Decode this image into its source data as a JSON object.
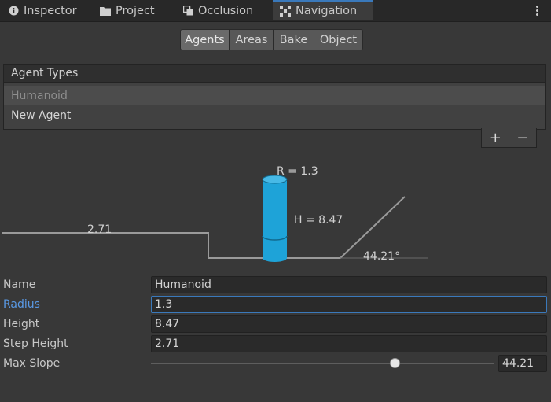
{
  "tabs": [
    {
      "label": "Inspector",
      "icon": "info-icon"
    },
    {
      "label": "Project",
      "icon": "folder-icon"
    },
    {
      "label": "Occlusion",
      "icon": "occlusion-icon"
    },
    {
      "label": "Navigation",
      "icon": "navigation-icon",
      "active": true
    }
  ],
  "toolbar": {
    "agents": "Agents",
    "areas": "Areas",
    "bake": "Bake",
    "object": "Object",
    "active": "Agents"
  },
  "agent_types": {
    "header": "Agent Types",
    "items": [
      "Humanoid",
      "New Agent"
    ],
    "selected": "Humanoid",
    "add": "+",
    "remove": "−"
  },
  "diagram": {
    "radius_label": "R = 1.3",
    "height_label": "H = 8.47",
    "step_label": "2.71",
    "slope_label": "44.21°",
    "agent_color": "#1ea3d8"
  },
  "properties": {
    "name_label": "Name",
    "name_value": "Humanoid",
    "radius_label": "Radius",
    "radius_value": "1.3",
    "height_label": "Height",
    "height_value": "8.47",
    "step_label": "Step Height",
    "step_value": "2.71",
    "slope_label": "Max Slope",
    "slope_value": "44.21",
    "slope_fraction": 0.7119
  }
}
